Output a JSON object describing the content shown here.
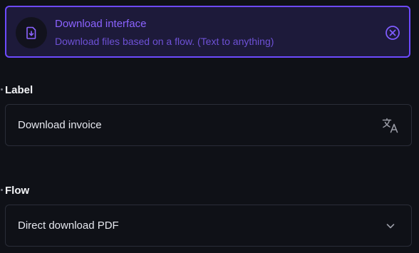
{
  "banner": {
    "title": "Download interface",
    "description": "Download files based on a flow. (Text to anything)",
    "icon": "file-download-icon",
    "close_icon": "close-circle-icon",
    "accent_color": "#6d4aff"
  },
  "label_field": {
    "label": "Label",
    "value": "Download invoice",
    "action_icon": "translate-icon"
  },
  "flow_field": {
    "label": "Flow",
    "value": "Direct download PDF",
    "action_icon": "chevron-down-icon"
  }
}
